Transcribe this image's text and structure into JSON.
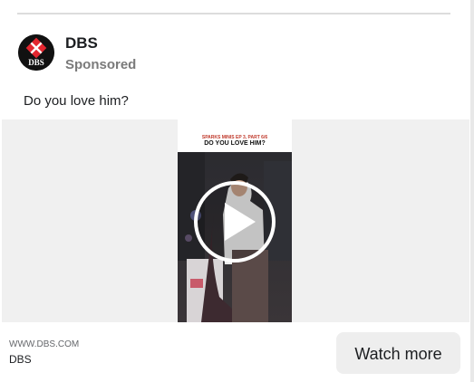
{
  "post": {
    "advertiser": "DBS",
    "sponsored_label": "Sponsored",
    "text": "Do you love him?",
    "avatar_logo_text": "DBS"
  },
  "video": {
    "series_text": "SPARKS MINIS EP 3, PART 6/6",
    "title_text": "DO YOU LOVE HIM?",
    "play_icon": "play-icon"
  },
  "footer": {
    "domain": "WWW.DBS.COM",
    "name": "DBS",
    "cta_label": "Watch more"
  },
  "colors": {
    "brand_red": "#e3262f",
    "cta_bg": "#eeeeee",
    "muted_text": "#7a7a7a"
  }
}
